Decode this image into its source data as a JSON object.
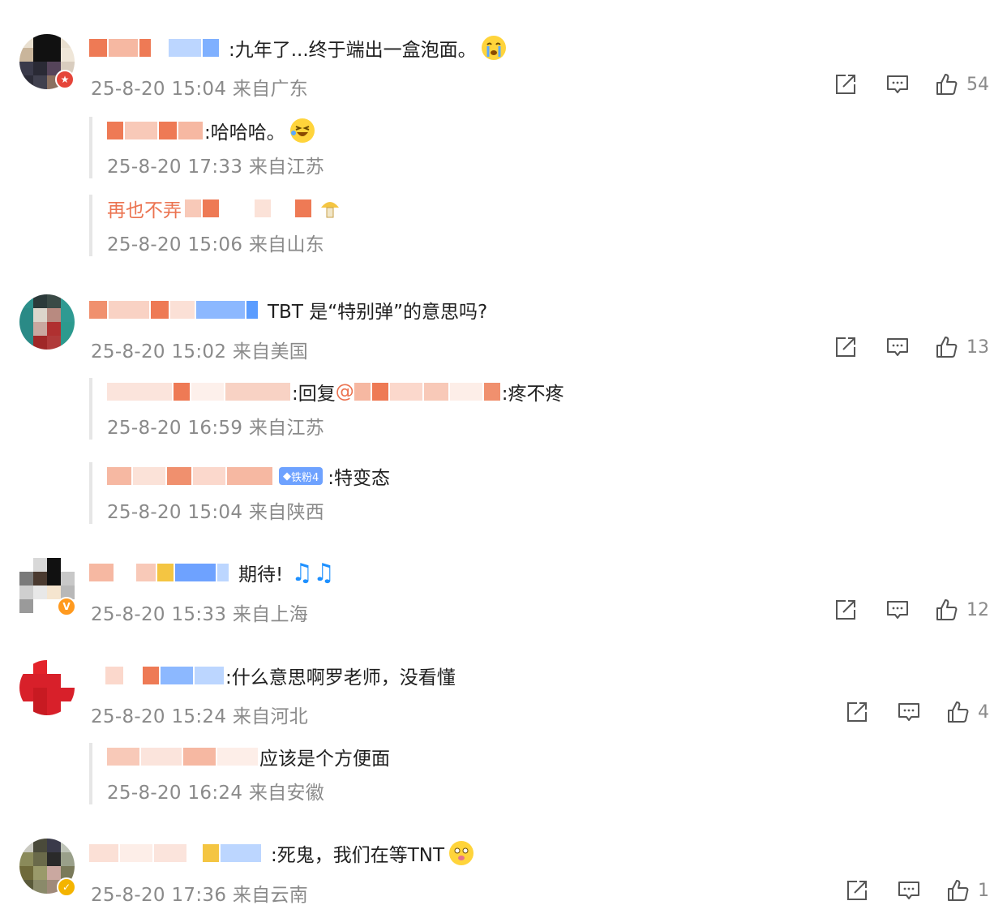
{
  "comments": [
    {
      "text": ":九年了...终于端出一盒泡面。",
      "meta": "25-8-20 15:04 来自广东",
      "likes": "54",
      "badge": "verified-red",
      "replies": [
        {
          "text": ":哈哈哈。",
          "meta": "25-8-20 17:33 来自江苏"
        },
        {
          "text": "再也不弄",
          "meta": "25-8-20 15:06 来自山东"
        }
      ]
    },
    {
      "text": "TBT 是“特别弹”的意思吗?",
      "meta": "25-8-20 15:02 来自美国",
      "likes": "13",
      "replies": [
        {
          "text": ":回复",
          "mention": "@",
          "tail": ":疼不疼",
          "meta": "25-8-20 16:59 来自江苏"
        },
        {
          "text": ":特变态",
          "fan": "铁粉4",
          "meta": "25-8-20 15:04 来自陕西"
        }
      ]
    },
    {
      "text": "期待!",
      "meta": "25-8-20 15:33 来自上海",
      "likes": "12",
      "badge": "verified-orange",
      "replies": []
    },
    {
      "text": ":什么意思啊罗老师，没看懂",
      "meta": "25-8-20 15:24 来自河北",
      "likes": "4",
      "replies": [
        {
          "text": "应该是个方便面",
          "meta": "25-8-20 16:24 来自安徽"
        }
      ]
    },
    {
      "text": ":死鬼，我们在等TNT",
      "meta": "25-8-20 17:36 来自云南",
      "likes": "1",
      "badge": "verified-yellow",
      "replies": []
    }
  ],
  "icons": {
    "share": "share-icon",
    "comment": "comment-icon",
    "like": "thumbs-up-icon"
  },
  "colors": {
    "meta": "#8a8a8a",
    "mention": "#eb7350",
    "fan_badge": "#6ea2ff"
  }
}
